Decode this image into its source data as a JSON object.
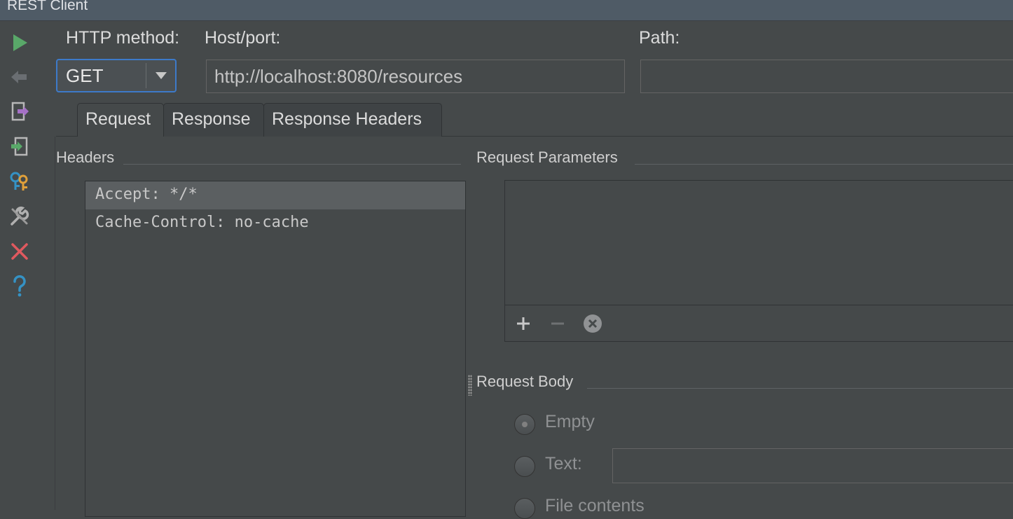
{
  "window": {
    "title": "REST Client"
  },
  "toolbar": {
    "icons": [
      "run-icon",
      "back-arrow-icon",
      "export-icon",
      "import-icon",
      "keys-icon",
      "wrench-icon",
      "close-icon",
      "help-icon"
    ]
  },
  "request_line": {
    "method_label": "HTTP method:",
    "method_value": "GET",
    "host_label": "Host/port:",
    "host_value": "http://localhost:8080/resources",
    "path_label": "Path:",
    "path_value": ""
  },
  "tabs": [
    {
      "label": "Request",
      "active": true
    },
    {
      "label": "Response",
      "active": false
    },
    {
      "label": "Response Headers",
      "active": false
    }
  ],
  "headers": {
    "title": "Headers",
    "items": [
      "Accept: */*",
      "Cache-Control: no-cache"
    ],
    "selected_index": 0
  },
  "params": {
    "title": "Request Parameters",
    "actions": [
      "add-icon",
      "remove-icon",
      "clear-icon"
    ]
  },
  "body": {
    "title": "Request Body",
    "options": [
      {
        "label": "Empty",
        "selected": true
      },
      {
        "label": "Text:",
        "selected": false
      },
      {
        "label": "File contents",
        "selected": false
      }
    ],
    "text_value": ""
  },
  "colors": {
    "background": "#45494a",
    "titlebar": "#4f5b66",
    "focus_border": "#3d7ac9",
    "run_green": "#59a869",
    "close_red": "#e0595f",
    "help_blue": "#3592c4"
  }
}
